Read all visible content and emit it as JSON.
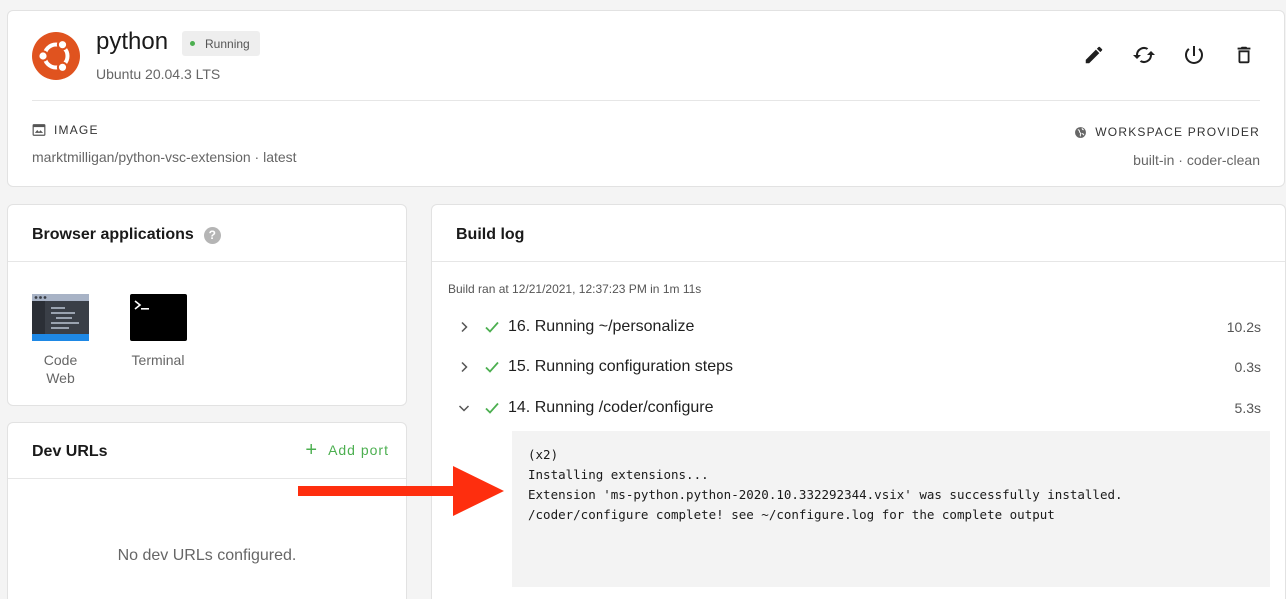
{
  "workspace": {
    "name": "python",
    "status": "Running",
    "os": "Ubuntu 20.04.3 LTS",
    "image_label": "IMAGE",
    "image_value": "marktmilligan/python-vsc-extension · latest",
    "provider_label": "WORKSPACE PROVIDER",
    "provider_value": "built-in · coder-clean",
    "icons": {
      "logo": "ubuntu-logo",
      "edit": "pencil-icon",
      "rebuild": "sync-icon",
      "power": "power-icon",
      "delete": "trash-icon",
      "image": "image-icon",
      "provider": "globe-icon"
    },
    "colors": {
      "ubuntu": "#e0531f",
      "running": "#4caf50"
    }
  },
  "apps": {
    "title": "Browser applications",
    "help": "?",
    "items": [
      {
        "label_1": "Code",
        "label_2": "Web",
        "icon": "code-web-icon"
      },
      {
        "label_1": "Terminal",
        "icon": "terminal-icon"
      }
    ]
  },
  "dev_urls": {
    "title": "Dev URLs",
    "add_plus": "+",
    "add_label": "Add port",
    "empty": "No dev URLs configured."
  },
  "build_log": {
    "title": "Build log",
    "build_ran": "Build ran at 12/21/2021, 12:37:23 PM in 1m 11s",
    "steps": [
      {
        "label": "16. Running ~/personalize",
        "duration": "10.2s",
        "expanded": false
      },
      {
        "label": "15. Running configuration steps",
        "duration": "0.3s",
        "expanded": false
      },
      {
        "label": "14. Running /coder/configure",
        "duration": "5.3s",
        "expanded": true
      }
    ],
    "log_lines": [
      "(x2)",
      "Installing extensions...",
      "Extension 'ms-python.python-2020.10.332292344.vsix' was successfully installed.",
      "/coder/configure complete! see ~/configure.log for the complete output"
    ],
    "success_color": "#4caf50"
  },
  "annotation": {
    "arrow_color": "#fe2e0e"
  }
}
